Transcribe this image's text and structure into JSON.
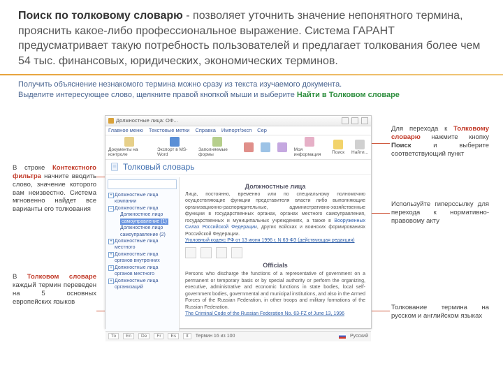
{
  "header": {
    "bold_lead": "Поиск по толковому словарю",
    "rest": " - позволяет уточнить значение непонятного термина, прояснить какое-либо профессиональное выражение. Система ГАРАНТ предусматривает такую потребность пользователей и предлагает толкования более чем 54 тыс. финансовых, юридических, экономических терминов."
  },
  "instruction": {
    "line1": "Получить объяснение незнакомого термина можно сразу из текста изучаемого документа.",
    "line2_a": "Выделите интересующее слово, щелкните правой кнопкой мыши и выберите ",
    "line2_green": "Найти в Толковом словаре"
  },
  "callouts": {
    "left1_a": "В строке ",
    "left1_red": "Контекстного фильтра",
    "left1_b": " начните вводить слово, значение которого вам неизвестно. Система мгновенно найдет все варианты его толкования",
    "left2_a": "В ",
    "left2_red": "Толковом словаре",
    "left2_b": " каждый термин переведен на 5 основных европейских языков",
    "right1_a": "Для перехода к ",
    "right1_red": "Толковому словарю",
    "right1_b": " нажмите кнопку ",
    "right1_c": "Поиск",
    "right1_d": " и выберите соответствующий пункт",
    "right2": "Используйте гиперссылку для перехода к нормативно-правовому акту",
    "right3": "Толкование термина на русском и английском языках"
  },
  "app": {
    "title": "Должностные лица: ОФ...",
    "menu": [
      "Главное меню",
      "Текстовые метки",
      "Справка",
      "Импорт/эксп",
      "Сер"
    ],
    "toolbar": [
      {
        "label": "Документы на контроле"
      },
      {
        "label": "Экспорт в MS-Word"
      },
      {
        "label": "Заполняемые формы"
      },
      {
        "label": ""
      },
      {
        "label": ""
      },
      {
        "label": ""
      },
      {
        "label": "Моя информация"
      },
      {
        "label": "Поиск"
      },
      {
        "label": "Найти..."
      }
    ],
    "content_title": "Толковый словарь",
    "tree": [
      "Должностные лица компании",
      "Должностные лица",
      "Должностное лицо",
      "самоуправление (1)",
      "Должностное лицо",
      "самоуправление (2)",
      "Должностные лица местного",
      "Должностные лица органов внутренних",
      "Должностные лица органов местного",
      "Должностные лица организаций"
    ],
    "tree_selected": "самоуправление (1)",
    "h_ru": "Должностные лица",
    "para_ru_a": "Лица, постоянно, временно или по специальному полномочию осуществляющие функции представителя власти либо выполняющие организационно-распорядительные, административно-хозяйственные функции в государственных органах, органах местного самоуправления, государственных и муниципальных учреждениях, а также в ",
    "para_ru_l1": "Вооруженных Силах Российской Федерации",
    "para_ru_b": ", других войсках и воинских формированиях Российской Федерации.",
    "link_ru": "Уголовный кодекс РФ от 13 июня 1996 г. N 63-ФЗ (действующая редакция)",
    "h_en": "Officials",
    "para_en": "Persons who discharge the functions of a representative of government on a permanent or temporary basis or by special authority or perform the organizing, executive, administrative and economic functions in state bodies, local self-government bodies, governmental and municipal institutions, and also in the Armed Forces of the Russian Federation, in other troops and military formations of the Russian Federation.",
    "link_en": "The Criminal Code of the Russian Federation No. 63-FZ of June 13, 1996",
    "status_tabs": [
      "То",
      "En",
      "De",
      "Fr",
      "Es",
      "It"
    ],
    "status_text": "Термин 16 из 100",
    "status_lang": "Русский"
  }
}
